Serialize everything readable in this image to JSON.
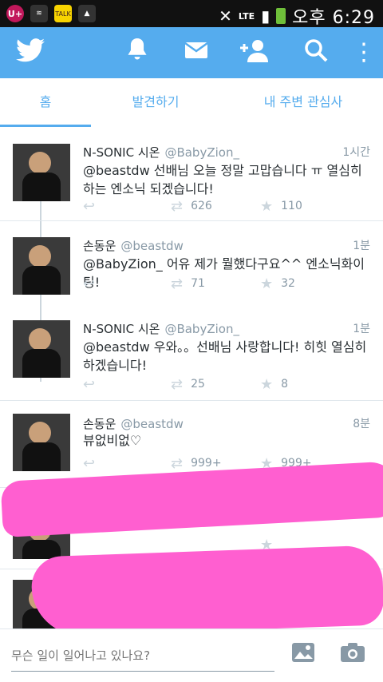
{
  "status_bar": {
    "carrier_icon": "U+",
    "time": "오후 6:29",
    "network": "LTE"
  },
  "tabs": [
    {
      "label": "홈"
    },
    {
      "label": "발견하기"
    },
    {
      "label": "내 주변 관심사"
    }
  ],
  "tweets": [
    {
      "name": "N-SONIC 시온",
      "handle": "@BabyZion_",
      "time": "1시간",
      "text": "@beastdw 선배님 오늘 정말 고맙습니다 ㅠ 열심히하는 엔소닉 되겠습니다!",
      "retweets": "626",
      "favorites": "110"
    },
    {
      "name": "손동운",
      "handle": "@beastdw",
      "time": "1분",
      "text": "@BabyZion_ 어유 제가 뭘했다구요^^ 엔소닉화이팅!",
      "retweets": "71",
      "favorites": "32"
    },
    {
      "name": "N-SONIC 시온",
      "handle": "@BabyZion_",
      "time": "1분",
      "text": "@beastdw 우와。。선배님 사랑합니다! 히힛 열심히하겠습니다!",
      "retweets": "25",
      "favorites": "8"
    },
    {
      "name": "손동운",
      "handle": "@beastdw",
      "time": "8분",
      "text": "뷰없비없♡",
      "retweets": "999+",
      "favorites": "999+"
    }
  ],
  "compose": {
    "placeholder": "무슨 일이 일어나고 있나요?"
  },
  "colors": {
    "twitter_blue": "#55acee",
    "redaction_pink": "#ff5fd0"
  }
}
